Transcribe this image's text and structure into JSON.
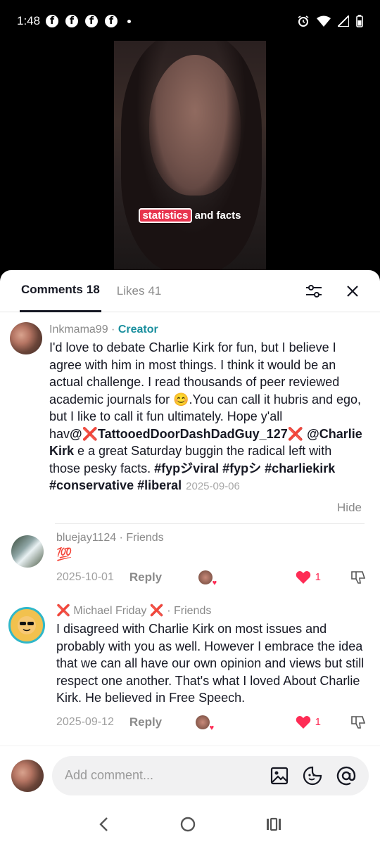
{
  "status": {
    "time": "1:48",
    "app_icons": [
      "facebook-icon",
      "facebook-icon",
      "facebook-icon",
      "facebook-icon"
    ]
  },
  "video": {
    "caption_highlight": "statistics",
    "caption_rest": "and facts"
  },
  "tabs": {
    "comments_label": "Comments",
    "comments_count": "18",
    "likes_label": "Likes",
    "likes_count": "41"
  },
  "comments": [
    {
      "username": "Inkmama99",
      "sep": " · ",
      "badge": "Creator",
      "text_parts": [
        "I'd love to debate Charlie Kirk for fun, but I believe I agree with him in most things. I think it would be an actual challenge. I read thousands of peer reviewed academic journals for ",
        "😊",
        ".You can call it hubris and ego, but I like to call it fun ultimately. Hope y'all hav",
        "@❌TattooedDoorDashDadGuy_127❌",
        " ",
        "@Charlie Kirk",
        " e a great Saturday buggin the radical left with those pesky facts. ",
        "#fypジviral",
        " ",
        "#fypシ",
        " ",
        "#charliekirk",
        " ",
        "#conservative",
        " ",
        "#liberal"
      ],
      "date": "2025-09-06",
      "hide_label": "Hide"
    },
    {
      "username": "bluejay1124",
      "sep": " · ",
      "badge": "Friends",
      "text": "💯",
      "date": "2025-10-01",
      "reply_label": "Reply",
      "likes": "1"
    },
    {
      "username": "❌ Michael Friday ❌",
      "sep": " · ",
      "badge": "Friends",
      "text": "I disagreed with Charlie Kirk on most issues and probably with you as well. However I embrace the idea that we can all have our own opinion and views but still respect one another. That's what I loved About Charlie Kirk. He believed in Free Speech.",
      "date": "2025-09-12",
      "reply_label": "Reply",
      "likes": "1"
    }
  ],
  "composer": {
    "placeholder": "Add comment..."
  },
  "colors": {
    "accent_red": "#fe2c55",
    "creator_teal": "#1a8f9e",
    "caption_highlight": "#e8344e"
  }
}
